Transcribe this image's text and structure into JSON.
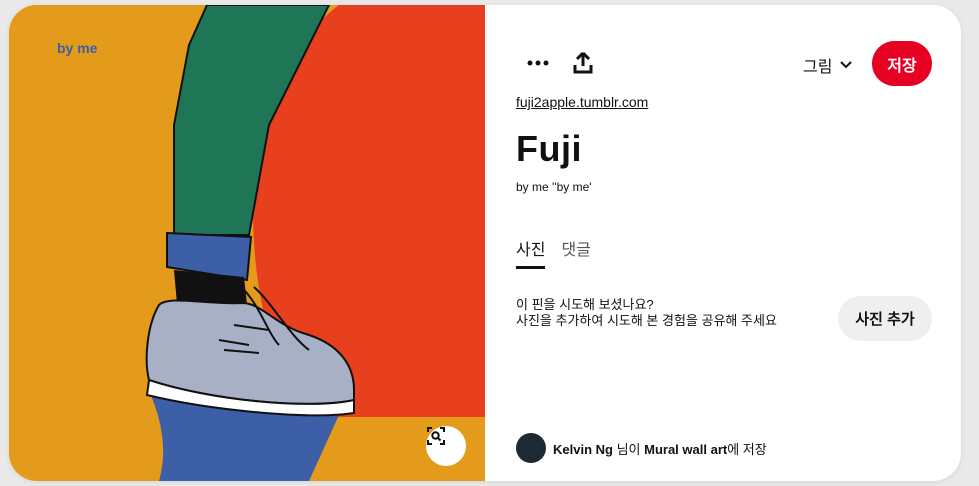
{
  "image": {
    "watermark": "by me",
    "colors": {
      "background": "#e49b1c",
      "red": "#e8401f",
      "pants": "#1e7656",
      "cuff": "#3d5fa8",
      "shadow": "#3d5fa8",
      "shoe": "#a7b0c5"
    }
  },
  "toolbar": {
    "more_icon": "more-icon",
    "share_icon": "share-icon",
    "board_label": "그림",
    "save_label": "저장",
    "save_color": "#e60023"
  },
  "pin": {
    "source": "fuji2apple.tumblr.com",
    "title": "Fuji",
    "description": "by me ''by me'"
  },
  "tabs": [
    {
      "label": "사진",
      "active": true
    },
    {
      "label": "댓글",
      "active": false
    }
  ],
  "tried": {
    "line1": "이 핀을 시도해 보셨나요?",
    "line2": "사진을 추가하여 시도해 본 경험을 공유해 주세요",
    "button": "사진 추가"
  },
  "saved_by": {
    "user": "Kelvin Ng",
    "connector": " 님이 ",
    "board": "Mural wall art",
    "suffix": "에 저장"
  }
}
